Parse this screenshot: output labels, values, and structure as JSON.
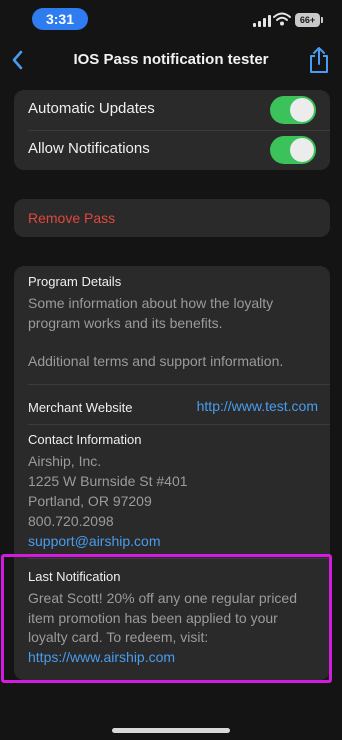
{
  "status": {
    "time": "3:31",
    "battery": "66+"
  },
  "nav": {
    "title": "IOS Pass notification tester"
  },
  "settings": {
    "automatic_updates": {
      "label": "Automatic Updates",
      "on": true
    },
    "allow_notifications": {
      "label": "Allow Notifications",
      "on": true
    }
  },
  "remove_pass": {
    "label": "Remove Pass"
  },
  "details": {
    "program": {
      "title": "Program Details",
      "text": "Some information about how the loyalty program works and its benefits.",
      "text2": "Additional terms and support information."
    },
    "merchant": {
      "label": "Merchant Website",
      "url": "http://www.test.com"
    },
    "contact": {
      "title": "Contact Information",
      "line1": "Airship, Inc.",
      "line2": "1225 W Burnside St #401",
      "line3": "Portland, OR 97209",
      "line4": "800.720.2098",
      "email": "support@airship.com"
    },
    "last_notification": {
      "title": "Last Notification",
      "text": "Great Scott! 20% off any one regular priced item promotion has been applied to your loyalty card. To redeem, visit:",
      "link": "https://www.airship.com"
    }
  },
  "colors": {
    "accent": "#4a9cf0",
    "toggle_on": "#3cc25a",
    "destructive": "#e1473f",
    "highlight": "#d31be0",
    "time_pill": "#2f7bf0"
  },
  "icons": [
    "back-chevron-icon",
    "share-icon",
    "signal-icon",
    "wifi-icon",
    "battery-icon"
  ]
}
